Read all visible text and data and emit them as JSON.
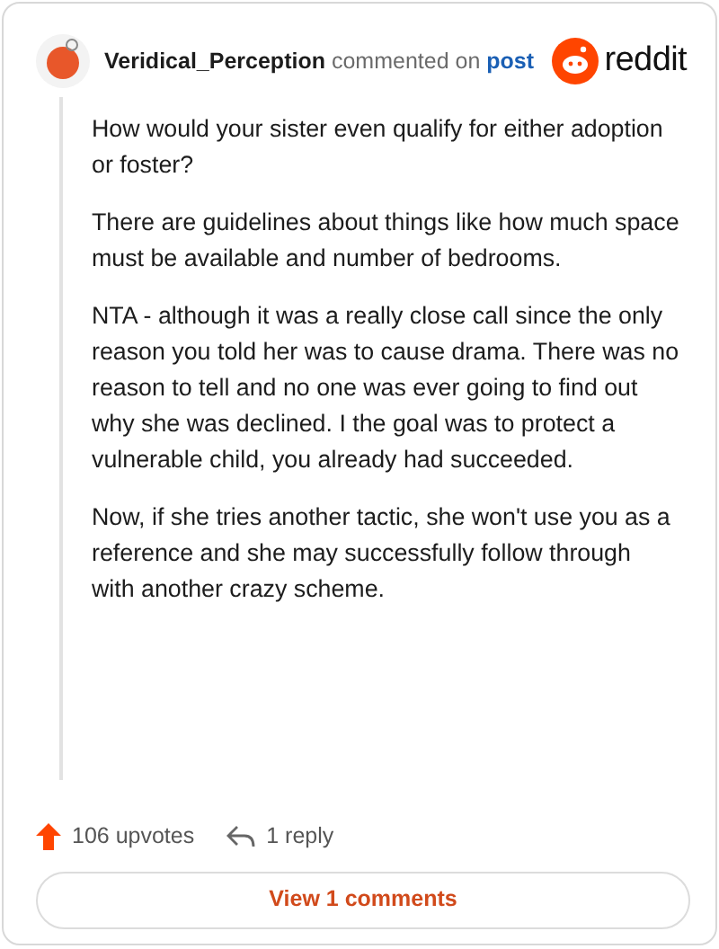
{
  "comment": {
    "author": "Veridical_Perception",
    "action": "commented on",
    "link": "post",
    "logo": "reddit",
    "paragraphs": [
      "How would your sister even qualify for either adoption or foster?",
      "There are guidelines about things like how much space must be available and number of bedrooms.",
      "NTA - although it was a really close call since the only reason you told her was to cause drama. There was no reason to tell and no one was ever going to find out why she was declined. I the goal was to protect a vulnerable child, you already had succeeded.",
      "Now, if she tries another tactic, she won't use you as a reference and she may successfully follow through with another crazy scheme."
    ],
    "upvotes": "106 upvotes",
    "replies": "1 reply",
    "view_button": "View 1 comments"
  }
}
